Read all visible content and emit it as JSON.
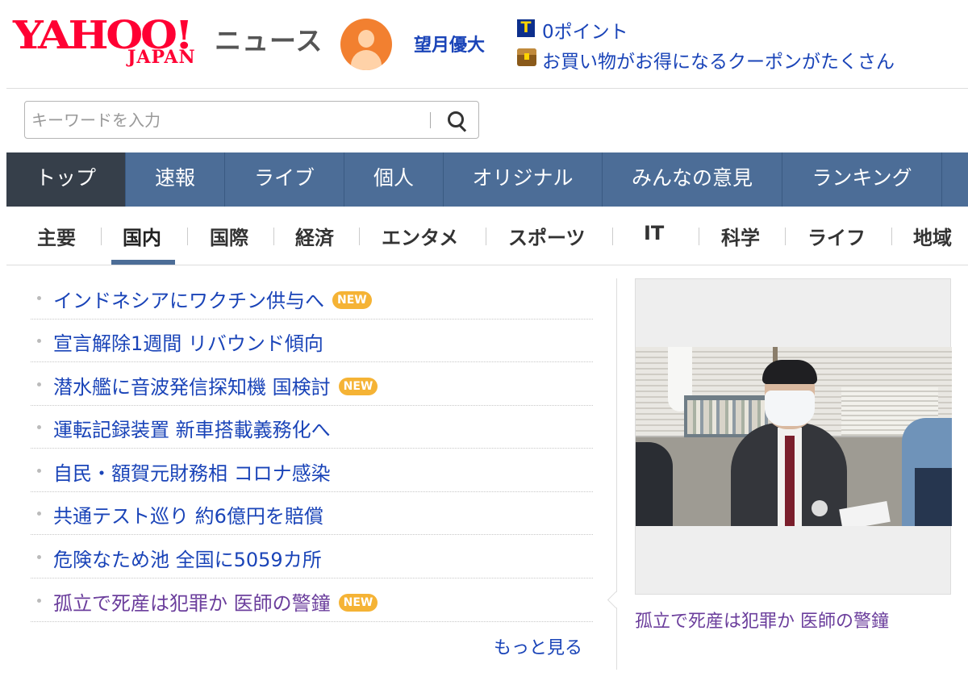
{
  "header": {
    "logo_main": "YAHOO!",
    "logo_sub": "JAPAN",
    "service_name": "ニュース",
    "username": "望月優大",
    "points": "0ポイント",
    "coupon_text": "お買い物がお得になるクーポンがたくさん",
    "tpoint_mark": "T"
  },
  "search": {
    "placeholder": "キーワードを入力",
    "value": ""
  },
  "main_nav": {
    "tabs": [
      {
        "label": "トップ",
        "active": true
      },
      {
        "label": "速報"
      },
      {
        "label": "ライブ"
      },
      {
        "label": "個人"
      },
      {
        "label": "オリジナル"
      },
      {
        "label": "みんなの意見"
      },
      {
        "label": "ランキング"
      }
    ]
  },
  "category_nav": {
    "tabs": [
      {
        "label": "主要"
      },
      {
        "label": "国内",
        "active": true
      },
      {
        "label": "国際"
      },
      {
        "label": "経済"
      },
      {
        "label": "エンタメ"
      },
      {
        "label": "スポーツ"
      },
      {
        "label": "IT"
      },
      {
        "label": "科学"
      },
      {
        "label": "ライフ"
      },
      {
        "label": "地域"
      }
    ]
  },
  "topics": {
    "items": [
      {
        "title": "インドネシアにワクチン供与へ",
        "badge": "NEW",
        "visited": false
      },
      {
        "title": "宣言解除1週間 リバウンド傾向",
        "badge": "",
        "visited": false
      },
      {
        "title": "潜水艦に音波発信探知機 国検討",
        "badge": "NEW",
        "visited": false
      },
      {
        "title": "運転記録装置 新車搭載義務化へ",
        "badge": "",
        "visited": false
      },
      {
        "title": "自民・額賀元財務相 コロナ感染",
        "badge": "",
        "visited": false
      },
      {
        "title": "共通テスト巡り 約6億円を賠償",
        "badge": "",
        "visited": false
      },
      {
        "title": "危険なため池 全国に5059カ所",
        "badge": "",
        "visited": false
      },
      {
        "title": "孤立で死産は犯罪か 医師の警鐘",
        "badge": "NEW",
        "visited": true
      }
    ],
    "more_label": "もっと見る"
  },
  "feature": {
    "caption": "孤立で死産は犯罪か 医師の警鐘"
  },
  "colors": {
    "brand": "#ff0033",
    "nav_bg": "#4c6d97",
    "nav_active": "#363f4a",
    "link": "#1a44b8",
    "visited": "#6b3e9c",
    "badge": "#f5b335"
  }
}
